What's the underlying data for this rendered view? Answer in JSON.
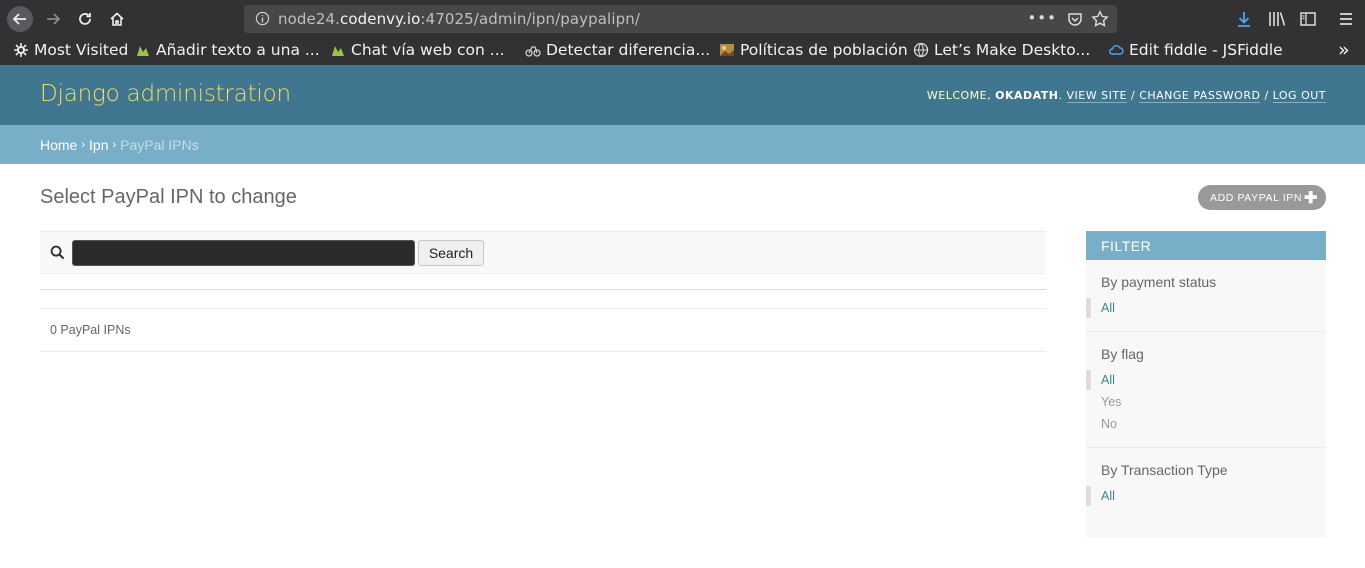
{
  "browser": {
    "url_prefix": "node24.",
    "url_host": "codenvy.io",
    "url_rest": ":47025/admin/ipn/paypalipn/",
    "more_label": "•••",
    "bookmarks": [
      {
        "label": "Most Visited",
        "icon": "gear-icon"
      },
      {
        "label": "Añadir texto a una ...",
        "icon": "django-icon"
      },
      {
        "label": "Chat vía web con ...",
        "icon": "django-icon"
      },
      {
        "label": "Detectar diferencia...",
        "icon": "bike-icon"
      },
      {
        "label": "Políticas de población",
        "icon": "image-icon"
      },
      {
        "label": "Let’s Make Deskto...",
        "icon": "globe-icon"
      },
      {
        "label": "Edit fiddle - JSFiddle",
        "icon": "cloud-icon"
      }
    ],
    "overflow_label": "»"
  },
  "header": {
    "branding": "Django administration",
    "welcome": "WELCOME, ",
    "username": "OKADATH",
    "after_user": ". ",
    "view_site": "VIEW SITE",
    "change_password": "CHANGE PASSWORD",
    "log_out": "LOG OUT",
    "sep": " / "
  },
  "breadcrumbs": {
    "home": "Home",
    "app": "Ipn",
    "current": "PayPal IPNs",
    "arrow": "›"
  },
  "content": {
    "title": "Select PayPal IPN to change",
    "add_button": "ADD PAYPAL IPN",
    "add_plus": "✚",
    "search_value": "",
    "search_button": "Search",
    "result_count": "0 PayPal IPNs"
  },
  "filter": {
    "title": "FILTER",
    "sections": [
      {
        "heading": "By payment status",
        "options": [
          "All"
        ]
      },
      {
        "heading": "By flag",
        "options": [
          "All",
          "Yes",
          "No"
        ]
      },
      {
        "heading": "By Transaction Type",
        "options": [
          "All"
        ]
      }
    ]
  },
  "colors": {
    "header_bg": "#417690",
    "breadcrumb_bg": "#79aec8",
    "branding": "#f5dd5d",
    "link": "#447e9b"
  }
}
